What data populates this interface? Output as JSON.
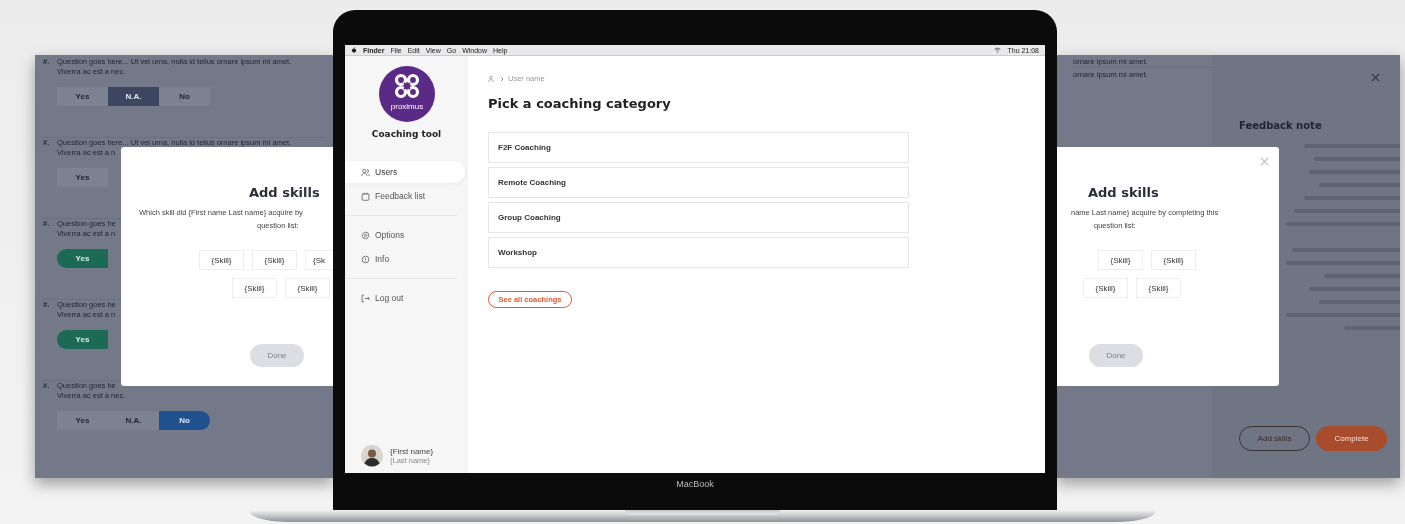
{
  "left_screen": {
    "questions": [
      {
        "number": "#.",
        "text": "Question goes here... Ut vel urna, nulla id tellus ornare ipsum mi amet.",
        "text_2": "Viverra ac est a nec.",
        "options": [
          {
            "label": "Yes",
            "kind": "yes",
            "selected": false
          },
          {
            "label": "N.A.",
            "kind": "na",
            "selected": true
          },
          {
            "label": "No",
            "kind": "no",
            "selected": false
          }
        ]
      },
      {
        "number": "#.",
        "text": "Question goes here... Ut vel urna, nulla id tellus ornare ipsum mi amet.",
        "text_2": "Viverra ac est a n",
        "options": [
          {
            "label": "Yes",
            "kind": "yes",
            "selected": false
          }
        ]
      },
      {
        "number": "#.",
        "text": "Question goes he",
        "text_2": "Viverra ac est a n",
        "options": [
          {
            "label": "Yes",
            "kind": "yes",
            "selected": true
          }
        ]
      },
      {
        "number": "#.",
        "text": "Question goes he",
        "text_2": "Viverra ac est a n",
        "options": [
          {
            "label": "Yes",
            "kind": "yes",
            "selected": true
          }
        ]
      },
      {
        "number": "#.",
        "text": "Question goes he",
        "text_2": "Viverra ac est a nec.",
        "options": [
          {
            "label": "Yes",
            "kind": "yes",
            "selected": false
          },
          {
            "label": "N.A.",
            "kind": "na",
            "selected": false
          },
          {
            "label": "No",
            "kind": "no",
            "selected": true
          }
        ]
      }
    ],
    "modal": {
      "title": "Add skills",
      "prompt": "Which skill did {First name Last name} acquire by",
      "prompt_2": "question list:",
      "skill_rows": [
        {
          "skills": [
            "{Skill}",
            "{Skill}",
            "{Sk"
          ]
        },
        {
          "skills": [
            "{Skill}",
            "{Skill}"
          ]
        }
      ],
      "done": {
        "label": "Done",
        "disabled": true
      }
    }
  },
  "laptop": {
    "menu_bar": {
      "items": [
        "Finder",
        "File",
        "Edit",
        "View",
        "Go",
        "Window",
        "Help"
      ],
      "clock": "Thu 21:08"
    },
    "sidebar": {
      "logo_text": "proximus",
      "app_name": "Coaching tool",
      "groups": [
        {
          "items": [
            {
              "label": "Users",
              "selected": true
            },
            {
              "label": "Feedback list",
              "selected": false
            }
          ]
        },
        {
          "items": [
            {
              "label": "Options",
              "selected": false
            },
            {
              "label": "Info",
              "selected": false
            }
          ]
        },
        {
          "items": [
            {
              "label": "Log out",
              "selected": false
            }
          ]
        }
      ],
      "user": {
        "first_name": "{First name}",
        "last_name": "{Last name}"
      }
    },
    "main": {
      "breadcrumb": "User name",
      "title": "Pick a coaching category",
      "categories": [
        "F2F Coaching",
        "Remote Coaching",
        "Group Coaching",
        "Workshop"
      ],
      "see_all": "See all coachings"
    },
    "brand": "MacBook"
  },
  "right_screen": {
    "question_tails": [
      "ornare ipsum mi amet.",
      "ornare ipsum mi amet."
    ],
    "modal": {
      "title": "Add skills",
      "prompt": "name Last name} acquire by completing this",
      "prompt_2": "question list:",
      "skill_rows": [
        {
          "skills": [
            "{Skill}",
            "{Skill}"
          ]
        },
        {
          "skills": [
            "{Skill}",
            "{Skill}"
          ]
        }
      ],
      "done": {
        "label": "Done",
        "disabled": true
      }
    },
    "panel": {
      "title": "Feedback note",
      "add_skills": "Add skills",
      "complete": "Complete"
    }
  }
}
